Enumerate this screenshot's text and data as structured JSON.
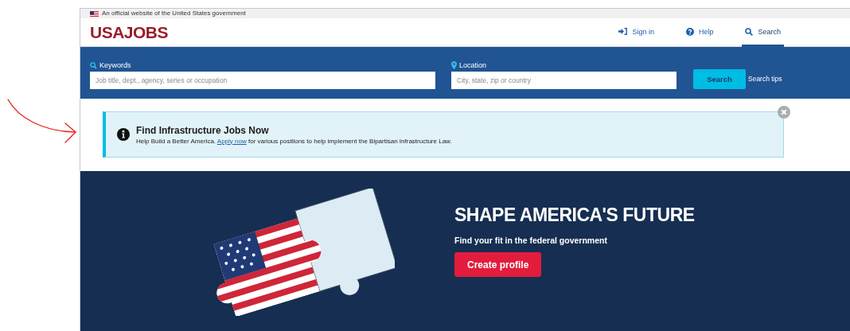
{
  "gov_banner": {
    "text": "An official website of the United States government"
  },
  "header": {
    "logo": "USAJOBS",
    "nav": [
      {
        "kind": "signin",
        "label": "Sign in",
        "selected": false
      },
      {
        "kind": "help",
        "label": "Help",
        "selected": false
      },
      {
        "kind": "search",
        "label": "Search",
        "selected": true
      }
    ]
  },
  "search_bar": {
    "keywords": {
      "label": "Keywords",
      "placeholder": "Job title, dept., agency, series or occupation"
    },
    "location": {
      "label": "Location",
      "placeholder": "City, state, zip or country"
    },
    "button": "Search",
    "tips_link": "Search tips"
  },
  "alert": {
    "title": "Find Infrastructure Jobs Now",
    "text_before": "Help Build a Better America. ",
    "link": "Apply now",
    "text_after": " for various positions to help implement the Bipartisan Infrastructure Law."
  },
  "hero": {
    "title": "SHAPE AMERICA'S FUTURE",
    "subtitle": "Find your fit in the federal government",
    "button": "Create profile"
  }
}
